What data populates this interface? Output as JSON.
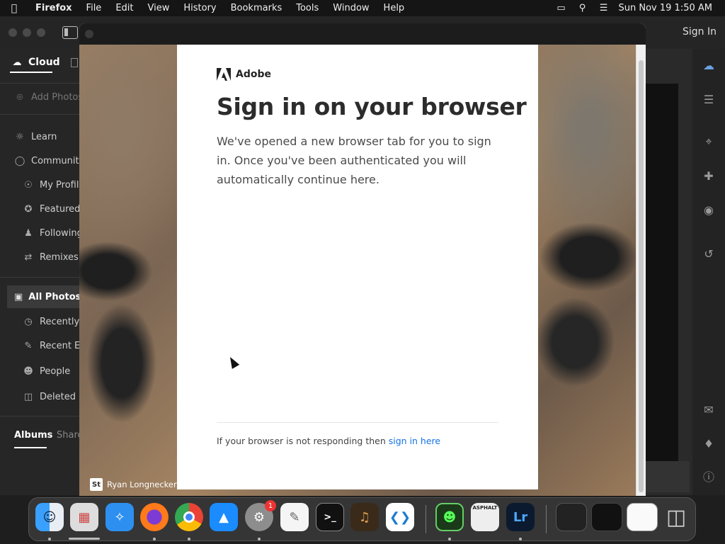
{
  "menubar": {
    "app": "Firefox",
    "items": [
      "File",
      "Edit",
      "View",
      "History",
      "Bookmarks",
      "Tools",
      "Window",
      "Help"
    ],
    "datetime": "Sun Nov 19  1:50 AM"
  },
  "lightroom": {
    "sign_in": "Sign In",
    "tabs": {
      "cloud": "Cloud"
    },
    "add_photos": "Add Photos",
    "learn": "Learn",
    "community": "Community",
    "community_items": [
      "My Profile",
      "Featured",
      "Following",
      "Remixes"
    ],
    "all_photos": "All Photos",
    "photo_items": [
      "Recently Added",
      "Recent Edits",
      "People",
      "Deleted"
    ],
    "albums": "Albums",
    "shared": "Shared"
  },
  "signin": {
    "brand": "Adobe",
    "title": "Sign in on your browser",
    "body": "We've opened a new browser tab for you to sign in. Once you've been authenticated you will automatically continue here.",
    "footer_text": "If your browser is not responding then ",
    "footer_link": "sign in here",
    "credit_badge": "St",
    "credit_name": "Ryan Longnecker"
  },
  "dock": {
    "settings_badge": "1",
    "asphalt_label": "ASPHALT",
    "lightroom_label": "Lr"
  },
  "colors": {
    "link": "#1473e6",
    "menubar_bg": "#151515",
    "lr_bg": "#2a2a2a"
  }
}
